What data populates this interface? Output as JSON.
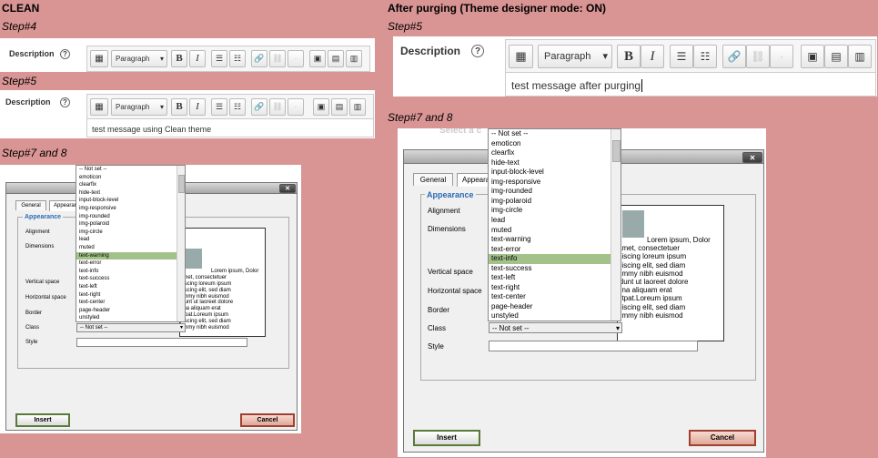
{
  "headings": {
    "left": "CLEAN",
    "right": "After purging (Theme designer mode: ON)"
  },
  "steps": {
    "left_4": "Step#4",
    "left_5": "Step#5",
    "left_7_8": "Step#7 and 8",
    "right_5": "Step#5",
    "right_7_8": "Step#7 and 8"
  },
  "editor": {
    "description_label": "Description",
    "help_glyph": "?",
    "paragraph_label": "Paragraph",
    "bold": "B",
    "italic": "I",
    "clean_message": "test message using Clean theme",
    "purged_message": "test message after purging"
  },
  "dialog": {
    "close_glyph": "✕",
    "tab_general": "General",
    "tab_appearance": "Appearance",
    "legend": "Appearance",
    "alignment": "Alignment",
    "dimensions": "Dimensions",
    "vertical_space": "Vertical space",
    "horizontal_space": "Horizontal space",
    "border": "Border",
    "class": "Class",
    "style": "Style",
    "class_selected": "-- Not set --",
    "insert": "Insert",
    "cancel": "Cancel",
    "preview_text": [
      "Lorem ipsum, Dolor",
      "amet, consectetuer",
      "piscing loreum ipsum",
      "piscing elit, sed diam",
      "ummy nibh euismod",
      "idunt ut laoreet dolore",
      "gna aliquam erat",
      "utpat.Loreum ipsum",
      "piscing elit, sed diam",
      "ummy nibh euismod"
    ],
    "behind_text": "Select a c"
  },
  "class_options": [
    "-- Not set --",
    "emoticon",
    "clearfix",
    "hide-text",
    "input-block-level",
    "img-responsive",
    "img-rounded",
    "img-polaroid",
    "img-circle",
    "lead",
    "muted",
    "text-warning",
    "text-error",
    "text-info",
    "text-success",
    "text-left",
    "text-right",
    "text-center",
    "page-header",
    "unstyled"
  ],
  "highlight": {
    "clean": "text-warning",
    "purged": "text-info"
  },
  "colors": {
    "background": "#d99494",
    "highlight": "#a2c28a",
    "legend": "#2a6bb5"
  }
}
